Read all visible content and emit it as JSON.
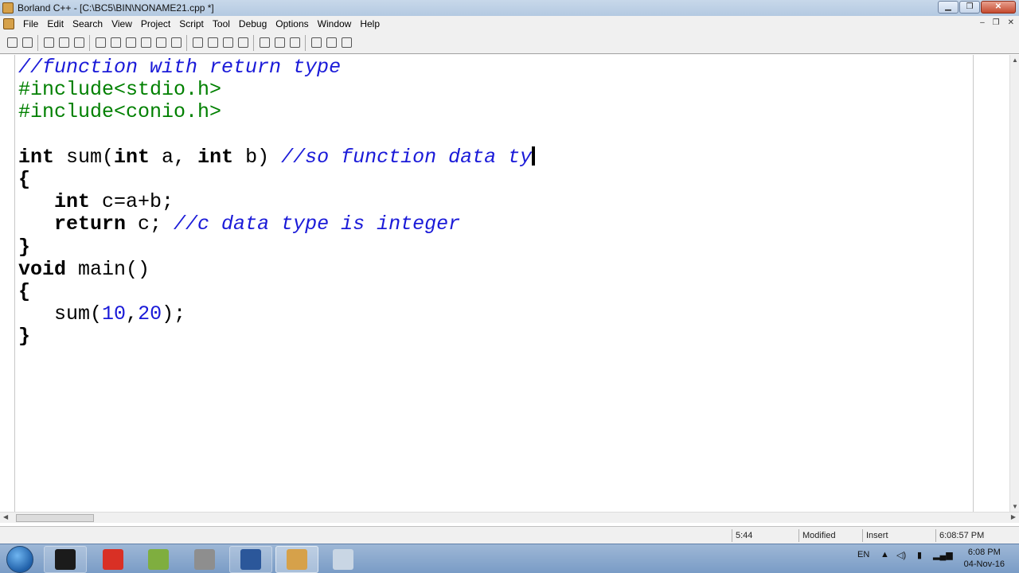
{
  "window": {
    "title": "Borland C++ - [C:\\BC5\\BIN\\NONAME21.cpp *]",
    "minimize_glyph": "▁",
    "restore_glyph": "❐",
    "close_glyph": "✕"
  },
  "menu": {
    "items": [
      "File",
      "Edit",
      "Search",
      "View",
      "Project",
      "Script",
      "Tool",
      "Debug",
      "Options",
      "Window",
      "Help"
    ],
    "mdi_minimize": "–",
    "mdi_restore": "❐",
    "mdi_close": "✕"
  },
  "toolbar": {
    "icons": [
      "open-icon",
      "save-icon",
      "cut-icon",
      "copy-icon",
      "paste-icon",
      "compile-icon",
      "make-icon",
      "run-icon",
      "build-icon",
      "debug-icon",
      "stop-icon",
      "undo-icon",
      "close-icon",
      "step-icon",
      "inspect-icon",
      "breakpoint-icon",
      "watch-icon",
      "evaluate-icon",
      "window-icon",
      "tile-icon",
      "help-icon"
    ]
  },
  "editor": {
    "code_lines": [
      [
        {
          "t": "//function with return type",
          "c": "cm"
        }
      ],
      [
        {
          "t": "#include<stdio.h>",
          "c": "pp"
        }
      ],
      [
        {
          "t": "#include<conio.h>",
          "c": "pp"
        }
      ],
      [],
      [
        {
          "t": "int",
          "c": "kw"
        },
        {
          "t": " sum(",
          "c": "id"
        },
        {
          "t": "int",
          "c": "kw"
        },
        {
          "t": " a, ",
          "c": "id"
        },
        {
          "t": "int",
          "c": "kw"
        },
        {
          "t": " b) ",
          "c": "id"
        },
        {
          "t": "//so function data ty",
          "c": "cm"
        },
        {
          "caret": true
        }
      ],
      [
        {
          "t": "{",
          "c": "kw"
        }
      ],
      [
        {
          "t": "   ",
          "c": "id"
        },
        {
          "t": "int",
          "c": "kw"
        },
        {
          "t": " c=a+b;",
          "c": "id"
        }
      ],
      [
        {
          "t": "   ",
          "c": "id"
        },
        {
          "t": "return",
          "c": "kw"
        },
        {
          "t": " c; ",
          "c": "id"
        },
        {
          "t": "//c data type is integer",
          "c": "cm"
        }
      ],
      [
        {
          "t": "}",
          "c": "kw"
        }
      ],
      [
        {
          "t": "void",
          "c": "kw"
        },
        {
          "t": " main()",
          "c": "id"
        }
      ],
      [
        {
          "t": "{",
          "c": "kw"
        }
      ],
      [
        {
          "t": "   sum(",
          "c": "id"
        },
        {
          "t": "10",
          "c": "nm"
        },
        {
          "t": ",",
          "c": "id"
        },
        {
          "t": "20",
          "c": "nm"
        },
        {
          "t": ");",
          "c": "id"
        }
      ],
      [
        {
          "t": "}",
          "c": "kw"
        }
      ]
    ]
  },
  "statusbar": {
    "position": "5:44",
    "state": "Modified",
    "mode": "Insert",
    "time": "6:08:57 PM"
  },
  "taskbar": {
    "language": "EN",
    "clock_time": "6:08 PM",
    "clock_date": "04-Nov-16",
    "apps": [
      {
        "name": "cmd-icon",
        "color": "#1b1b1b",
        "state": "open"
      },
      {
        "name": "chrome-icon",
        "color": "#d93025",
        "state": "none"
      },
      {
        "name": "notepad-icon",
        "color": "#7fae3f",
        "state": "none"
      },
      {
        "name": "printer-icon",
        "color": "#8e8e8e",
        "state": "none"
      },
      {
        "name": "word-icon",
        "color": "#2b579a",
        "state": "open"
      },
      {
        "name": "borland-icon",
        "color": "#d6a14a",
        "state": "active"
      },
      {
        "name": "calculator-icon",
        "color": "#c9d6e4",
        "state": "none"
      }
    ]
  }
}
